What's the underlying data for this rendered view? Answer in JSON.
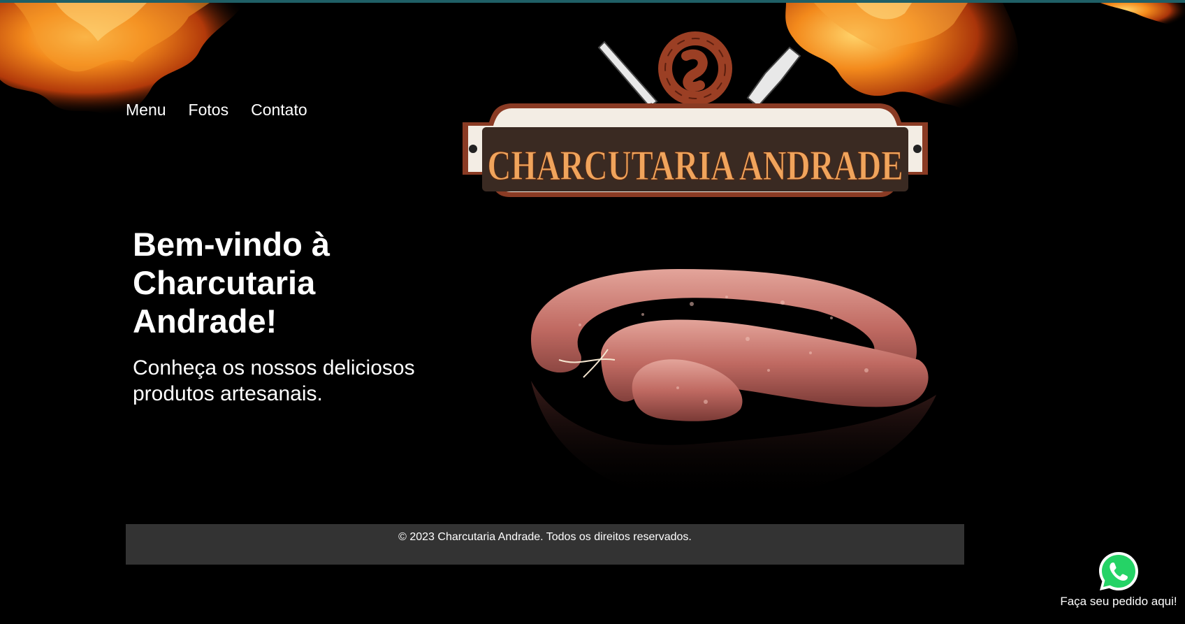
{
  "nav": {
    "items": [
      {
        "label": "Menu"
      },
      {
        "label": "Fotos"
      },
      {
        "label": "Contato"
      }
    ]
  },
  "logo": {
    "text": "CHARCUTARIA ANDRADE",
    "colors": {
      "board": "#3a2a22",
      "frame": "#f3ede4",
      "border": "#8a3b24",
      "lettering": "#f0a45c",
      "sausage": "#9b3f24"
    }
  },
  "hero": {
    "title": "Bem-vindo à Charcutaria Andrade!",
    "subtitle": "Conheça os nossos deliciosos produtos artesanais."
  },
  "footer": {
    "text": "© 2023 Charcutaria Andrade. Todos os direitos reservados."
  },
  "whatsapp": {
    "icon": "whatsapp-icon",
    "label": "Faça seu pedido aqui!",
    "color": "#25d366"
  },
  "colors": {
    "background": "#000000",
    "top_bar": "#1f5f66",
    "footer_bg": "#333333",
    "flame": "#f07a12"
  }
}
